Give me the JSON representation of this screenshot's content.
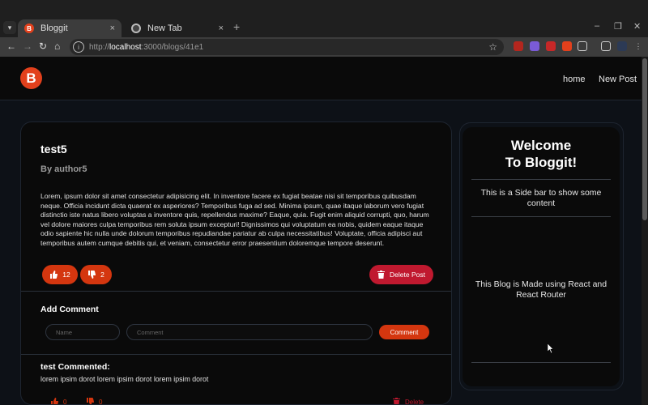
{
  "browser": {
    "tabs": [
      {
        "title": "Bloggit",
        "favicon_letter": "B",
        "close": "×"
      },
      {
        "title": "New Tab",
        "close": "×"
      }
    ],
    "new_tab": "+",
    "window_controls": {
      "minimize": "–",
      "restore": "❐",
      "close": "✕"
    },
    "nav": {
      "back": "←",
      "forward": "→",
      "reload": "↻",
      "home": "⌂"
    },
    "url": {
      "protocol": "http://",
      "host": "localhost",
      "path": ":3000/blogs/41e1"
    },
    "bookmark": "☆",
    "colors": {
      "tabbar": "#1f1f1f",
      "toolbar": "#3c3c3c"
    }
  },
  "app": {
    "logo_letter": "B",
    "nav": {
      "home": "home",
      "new_post": "New Post"
    },
    "accent": "#d4360f",
    "danger": "#c0192f"
  },
  "post": {
    "title": "test5",
    "author": "By author5",
    "body": "Lorem, ipsum dolor sit amet consectetur adipisicing elit. In inventore facere ex fugiat beatae nisi sit temporibus quibusdam neque. Officia incidunt dicta quaerat ex asperiores? Temporibus fuga ad sed. Minima ipsum, quae itaque laborum vero fugiat distinctio iste natus libero voluptas a inventore quis, repellendus maxime? Eaque, quia. Fugit enim aliquid corrupti, quo, harum vel dolore maiores culpa temporibus rem soluta ipsum excepturi! Dignissimos qui voluptatum ea nobis, quidem eaque itaque odio sapiente hic nulla unde dolorum temporibus repudiandae pariatur ab culpa necessitatibus! Voluptate, officia adipisci aut temporibus autem cumque debitis qui, et veniam, consectetur error praesentium doloremque tempore deserunt.",
    "likes": "12",
    "dislikes": "2",
    "delete_label": "Delete Post"
  },
  "add_comment": {
    "title": "Add Comment",
    "name_placeholder": "Name",
    "comment_placeholder": "Comment",
    "button": "Comment"
  },
  "comments": [
    {
      "author": "test Commented:",
      "text": "lorem ipsim dorot lorem ipsim dorot lorem ipsim dorot",
      "likes": "0",
      "dislikes": "0",
      "delete_label": "Delete"
    }
  ],
  "sidebar": {
    "title_line1": "Welcome",
    "title_line2": "To Bloggit!",
    "text1": "This is a Side bar to show some content",
    "text2": "This Blog is Made using React and React Router"
  }
}
